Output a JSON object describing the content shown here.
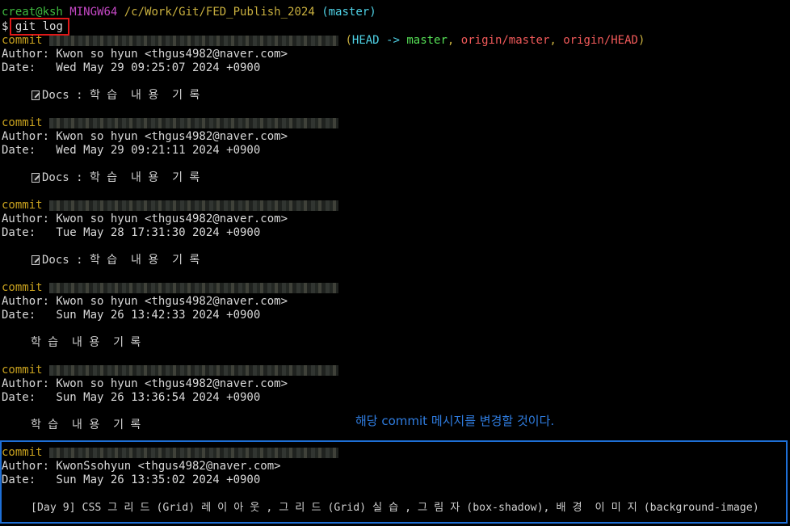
{
  "prompt": {
    "user": "creat@ksh",
    "shell": "MINGW64",
    "path": "/c/Work/Git/FED_Publish_2024",
    "branch": "(master)",
    "symbol": "$",
    "command": "git log"
  },
  "refs": {
    "open": "(",
    "head": "HEAD ->",
    "master": "master",
    "sep1": ",",
    "origin_master": "origin/master",
    "sep2": ",",
    "origin_head": "origin/HEAD",
    "close": ")"
  },
  "commits": [
    {
      "label": "commit",
      "author": "Author: Kwon so hyun <thgus4982@naver.com>",
      "date": "Date:   Wed May 29 09:25:07 2024 +0900",
      "message": "Docs : 학 습  내 용  기 록",
      "icon": "memo-icon"
    },
    {
      "label": "commit",
      "author": "Author: Kwon so hyun <thgus4982@naver.com>",
      "date": "Date:   Wed May 29 09:21:11 2024 +0900",
      "message": "Docs : 학 습  내 용  기 록",
      "icon": "memo-icon"
    },
    {
      "label": "commit",
      "author": "Author: Kwon so hyun <thgus4982@naver.com>",
      "date": "Date:   Tue May 28 17:31:30 2024 +0900",
      "message": "Docs : 학 습  내 용  기 록",
      "icon": "memo-icon"
    },
    {
      "label": "commit",
      "author": "Author: Kwon so hyun <thgus4982@naver.com>",
      "date": "Date:   Sun May 26 13:42:33 2024 +0900",
      "message": "학 습  내 용  기 록"
    },
    {
      "label": "commit",
      "author": "Author: Kwon so hyun <thgus4982@naver.com>",
      "date": "Date:   Sun May 26 13:36:54 2024 +0900",
      "message": "학 습  내 용  기 록"
    },
    {
      "label": "commit",
      "author": "Author: KwonSsohyun <thgus4982@naver.com>",
      "date": "Date:   Sun May 26 13:35:02 2024 +0900",
      "message": "[Day 9] CSS 그 리 드 (Grid) 레 이 아 웃 , 그 리 드 (Grid) 실 습 , 그 림 자 (box-shadow), 배 경  이 미 지 (background-image)"
    }
  ],
  "annotation": "해당 commit 메시지를 변경할 것이다.",
  "colors": {
    "annotation_blue": "#1e6fd6",
    "highlight_red": "#e01818"
  }
}
